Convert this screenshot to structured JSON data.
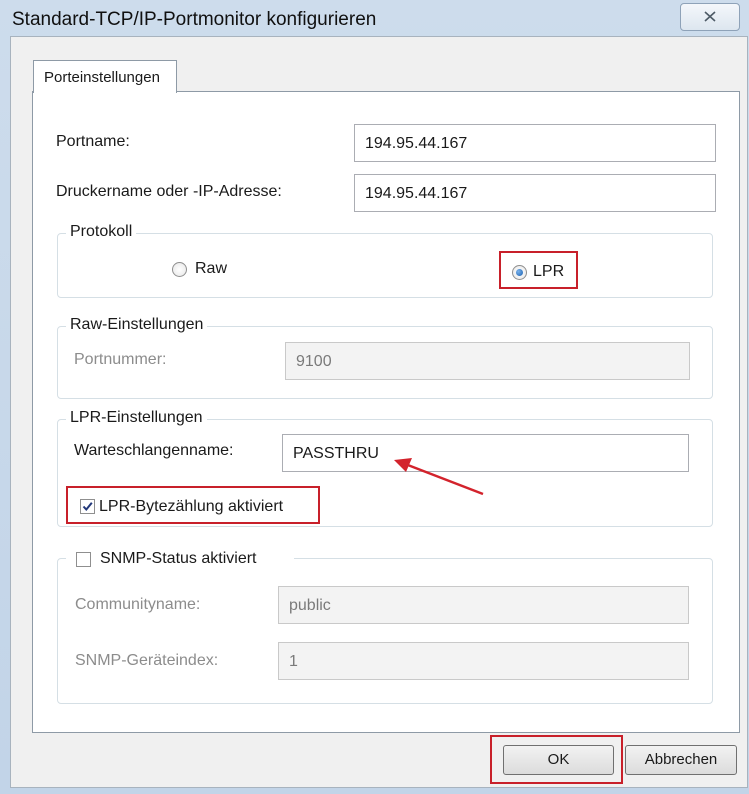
{
  "window": {
    "title": "Standard-TCP/IP-Portmonitor konfigurieren"
  },
  "tabs": [
    {
      "label": "Porteinstellungen"
    }
  ],
  "port": {
    "portname_label": "Portname:",
    "portname_value": "194.95.44.167",
    "printer_label": "Druckername oder -IP-Adresse:",
    "printer_value": "194.95.44.167"
  },
  "protocol": {
    "legend": "Protokoll",
    "raw_label": "Raw",
    "lpr_label": "LPR",
    "selected": "LPR"
  },
  "raw_settings": {
    "legend": "Raw-Einstellungen",
    "portnumber_label": "Portnummer:",
    "portnumber_value": "9100"
  },
  "lpr_settings": {
    "legend": "LPR-Einstellungen",
    "queue_label": "Warteschlangenname:",
    "queue_value": "PASSTHRU",
    "bytecount_label": "LPR-Bytezählung aktiviert",
    "bytecount_checked": true
  },
  "snmp": {
    "label": "SNMP-Status aktiviert",
    "checked": false,
    "community_label": "Communityname:",
    "community_value": "public",
    "index_label": "SNMP-Geräteindex:",
    "index_value": "1"
  },
  "buttons": {
    "ok": "OK",
    "cancel": "Abbrechen"
  },
  "colors": {
    "highlight": "#c8202a",
    "radio_selected": "#1a5fb0"
  }
}
